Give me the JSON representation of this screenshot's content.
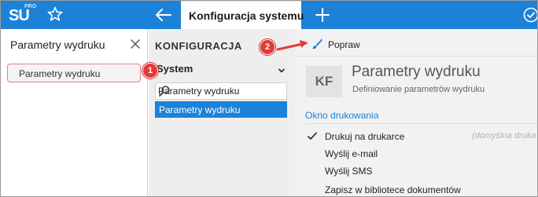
{
  "app": {
    "logo_main": "SU",
    "logo_sup": "PRO",
    "brand_color": "#1c82d8"
  },
  "topbar": {
    "active_tab": "Konfiguracja systemu",
    "icons": [
      "star-icon",
      "back-arrow-icon",
      "plus-icon",
      "check-circle-icon"
    ]
  },
  "left_panel": {
    "search_value": "Parametry wydruku",
    "results": [
      {
        "label": "Parametry wydruku"
      }
    ]
  },
  "middle_panel": {
    "title": "KONFIGURACJA",
    "select_value": "System",
    "search_value": "Parametry wydruku",
    "items": [
      {
        "label": "Parametry wydruku",
        "active": true
      }
    ]
  },
  "right_panel": {
    "toolbar": {
      "edit_label": "Popraw"
    },
    "header": {
      "badge": "KF",
      "title": "Parametry wydruku",
      "subtitle": "Definiowanie parametrów wydruku"
    },
    "section_title": "Okno drukowania",
    "options": [
      {
        "label": "Drukuj na drukarce",
        "checked": true,
        "hint": "(domyślna druka"
      },
      {
        "label": "Wyślij e-mail",
        "checked": false,
        "hint": ""
      },
      {
        "label": "Wyślij SMS",
        "checked": false,
        "hint": ""
      },
      {
        "label": "Zapisz w bibliotece dokumentów",
        "checked": false,
        "hint": ""
      }
    ]
  },
  "annotations": [
    {
      "number": "1"
    },
    {
      "number": "2"
    }
  ]
}
